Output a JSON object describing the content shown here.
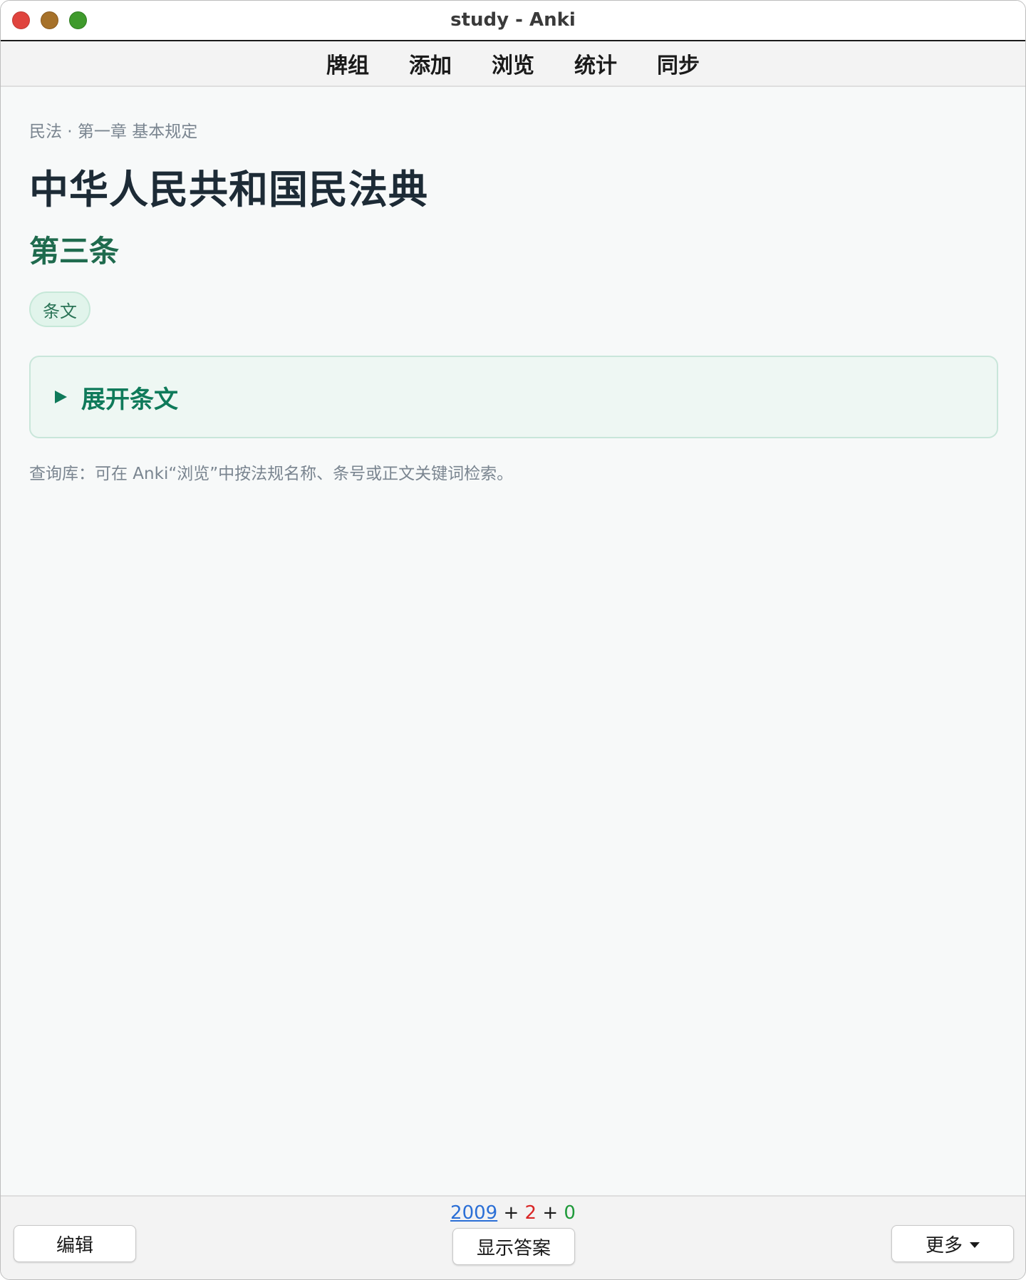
{
  "window": {
    "title": "study - Anki"
  },
  "toolbar": {
    "items": [
      "牌组",
      "添加",
      "浏览",
      "统计",
      "同步"
    ]
  },
  "card": {
    "breadcrumb": "民法 · 第一章 基本规定",
    "law_title": "中华人民共和国民法典",
    "article_title": "第三条",
    "tag": "条文",
    "expand_label": "展开条文",
    "hint": "查询库：可在 Anki“浏览”中按法规名称、条号或正文关键词检索。"
  },
  "counts": {
    "new": "2009",
    "plus1": "+",
    "learn": "2",
    "plus2": "+",
    "review": "0"
  },
  "bottom": {
    "edit_label": "编辑",
    "show_answer_label": "显示答案",
    "more_label": "更多"
  },
  "colors": {
    "accent_green": "#0f7a5a",
    "count_new": "#2b6fd6",
    "count_learn": "#d92626",
    "count_review": "#1f9a3a"
  }
}
